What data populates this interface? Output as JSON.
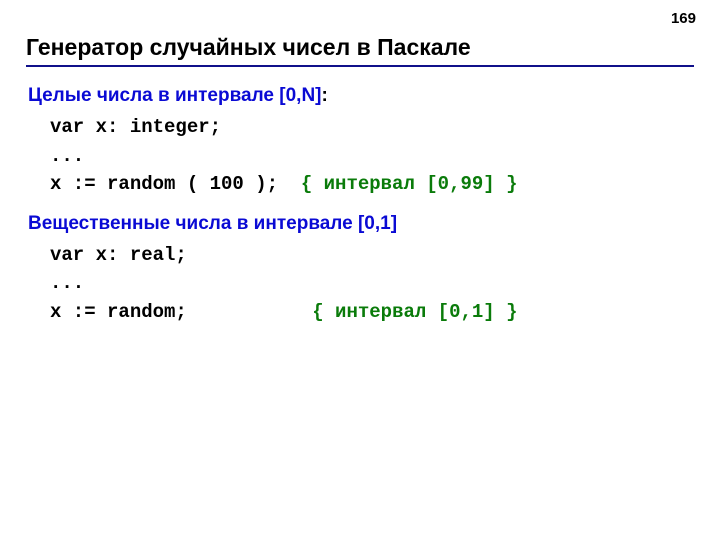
{
  "page_number": "169",
  "title": "Генератор случайных чисел в Паскале",
  "section1": {
    "heading": "Целые числа в интервале [0,N]",
    "colon": ":",
    "code_line1": "var x: integer;",
    "code_line2": "...",
    "code_line3a": "x := random ( 100 );  ",
    "code_line3b": "{ интервал [0,99] }"
  },
  "section2": {
    "heading": "Вещественные числа в интервале [0,1]",
    "code_line1": "var x: real;",
    "code_line2": "...",
    "code_line3a": "x := random;           ",
    "code_line3b": "{ интервал [0,1] }"
  }
}
